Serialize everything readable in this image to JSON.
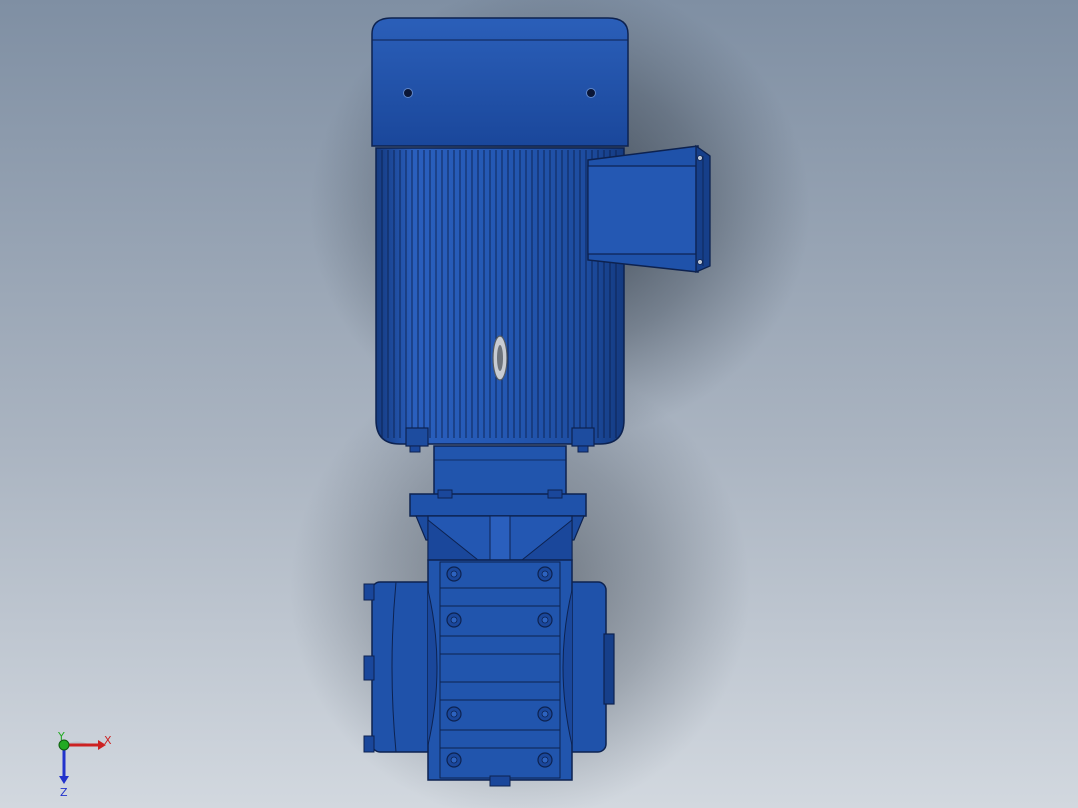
{
  "scene": {
    "subject": "gear-motor-model",
    "background_top": "#7f8fa3",
    "background_bottom": "#d2d8df",
    "body_color": "#1f50a6",
    "body_shade": "#143a80",
    "body_light": "#2d63c0",
    "line_color": "#0d2250"
  },
  "triad": {
    "labels": {
      "x": "X",
      "y": "Y",
      "z": "Z"
    },
    "colors": {
      "x": "#cc2222",
      "y": "#22aa22",
      "z": "#2233cc"
    }
  }
}
